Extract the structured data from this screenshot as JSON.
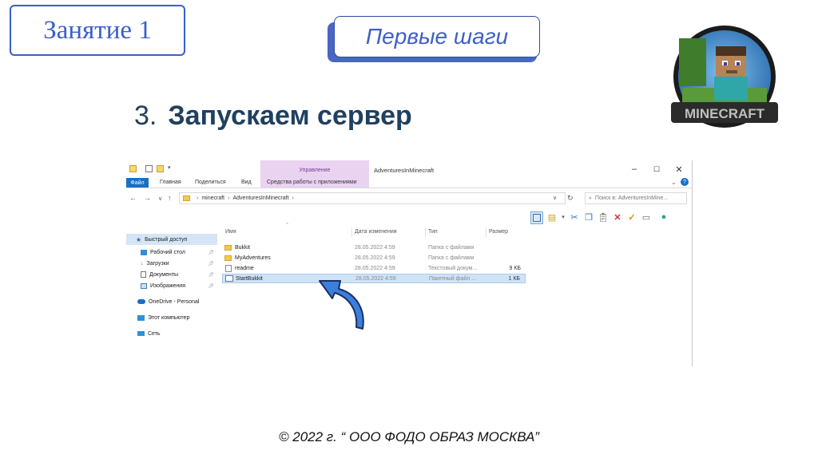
{
  "slide": {
    "lesson": "Занятие 1",
    "steps_label": "Первые шаги",
    "step_number": "3.",
    "step_title": "Запускаем сервер",
    "footer": "© 2022 г. “ ООО ФОДО ОБРАЗ МОСКВА”",
    "logo_text": "MINECRAFT"
  },
  "explorer": {
    "manage_label": "Управление",
    "window_title": "AdventuresInMinecraft",
    "controls": {
      "minimize": "–",
      "maximize": "☐",
      "close": "✕"
    },
    "ribbon_tabs": [
      "Файл",
      "Главная",
      "Поделиться",
      "Вид",
      "Средства работы с приложениями"
    ],
    "address": [
      "minecraft",
      "AdventuresInMinecraft"
    ],
    "search_placeholder": "Поиск в: AdventuresInMine...",
    "sidebar": [
      {
        "label": "Быстрый доступ",
        "icon": "star-icon"
      },
      {
        "label": "Рабочий стол",
        "icon": "desktop-icon"
      },
      {
        "label": "Загрузки",
        "icon": "download-icon"
      },
      {
        "label": "Документы",
        "icon": "documents-icon"
      },
      {
        "label": "Изображения",
        "icon": "pictures-icon"
      },
      {
        "label": "OneDrive - Personal",
        "icon": "cloud-icon"
      },
      {
        "label": "Этот компьютер",
        "icon": "computer-icon"
      },
      {
        "label": "Сеть",
        "icon": "network-icon"
      }
    ],
    "columns": {
      "name": "Имя",
      "date": "Дата изменения",
      "type": "Тип",
      "size": "Размер"
    },
    "files": [
      {
        "name": "Bukkit",
        "date": "28.05.2022 4:59",
        "type": "Папка с файлами",
        "size": "",
        "icon": "folder-icon"
      },
      {
        "name": "MyAdventures",
        "date": "28.05.2022 4:59",
        "type": "Папка с файлами",
        "size": "",
        "icon": "folder-icon"
      },
      {
        "name": "readme",
        "date": "28.05.2022 4:59",
        "type": "Текстовый докум...",
        "size": "9 КБ",
        "icon": "text-file-icon"
      },
      {
        "name": "StartBukkit",
        "date": "28.05.2022 4:59",
        "type": "Пакетный файл ...",
        "size": "1 КБ",
        "icon": "batch-file-icon"
      }
    ]
  },
  "colors": {
    "accent": "#3b5fc9",
    "heading": "#1f4060",
    "arrow": "#3b7fdc",
    "selection": "#cfe3f7"
  }
}
